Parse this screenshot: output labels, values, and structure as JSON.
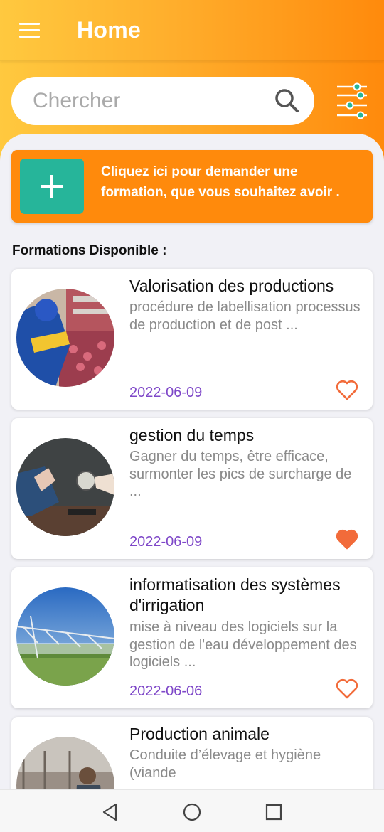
{
  "header": {
    "title": "Home"
  },
  "search": {
    "placeholder": "Chercher"
  },
  "colors": {
    "accent_start": "#ffc93f",
    "accent_end": "#ff8a0c",
    "plus_button": "#26b59a",
    "date": "#7e47c8",
    "heart": "#f26b3a"
  },
  "banner": {
    "text": "Cliquez ici pour demander une formation, que vous souhaitez avoir ."
  },
  "section": {
    "title": "Formations Disponible :"
  },
  "formations": [
    {
      "title": "Valorisation des productions",
      "description": "procédure de labellisation processus de production et de post ...",
      "date": "2022-06-09",
      "favorite": false,
      "image": "workers-sorting-produce"
    },
    {
      "title": "gestion du temps",
      "description": "Gagner du temps, être efficace, surmonter les pics de surcharge de ...",
      "date": "2022-06-09",
      "favorite": true,
      "image": "clock-in-hand"
    },
    {
      "title": "informatisation des systèmes d'irrigation",
      "description": "mise à niveau des logiciels sur la gestion de l'eau développement des logiciels ...",
      "date": "2022-06-06",
      "favorite": false,
      "image": "pivot-irrigation"
    },
    {
      "title": "Production animale",
      "description": "Conduite d’élevage et hygiène (viande",
      "date": "",
      "favorite": false,
      "image": "livestock-barn"
    }
  ],
  "navbar": {
    "icons": [
      "back-icon",
      "home-icon",
      "recents-icon"
    ]
  }
}
